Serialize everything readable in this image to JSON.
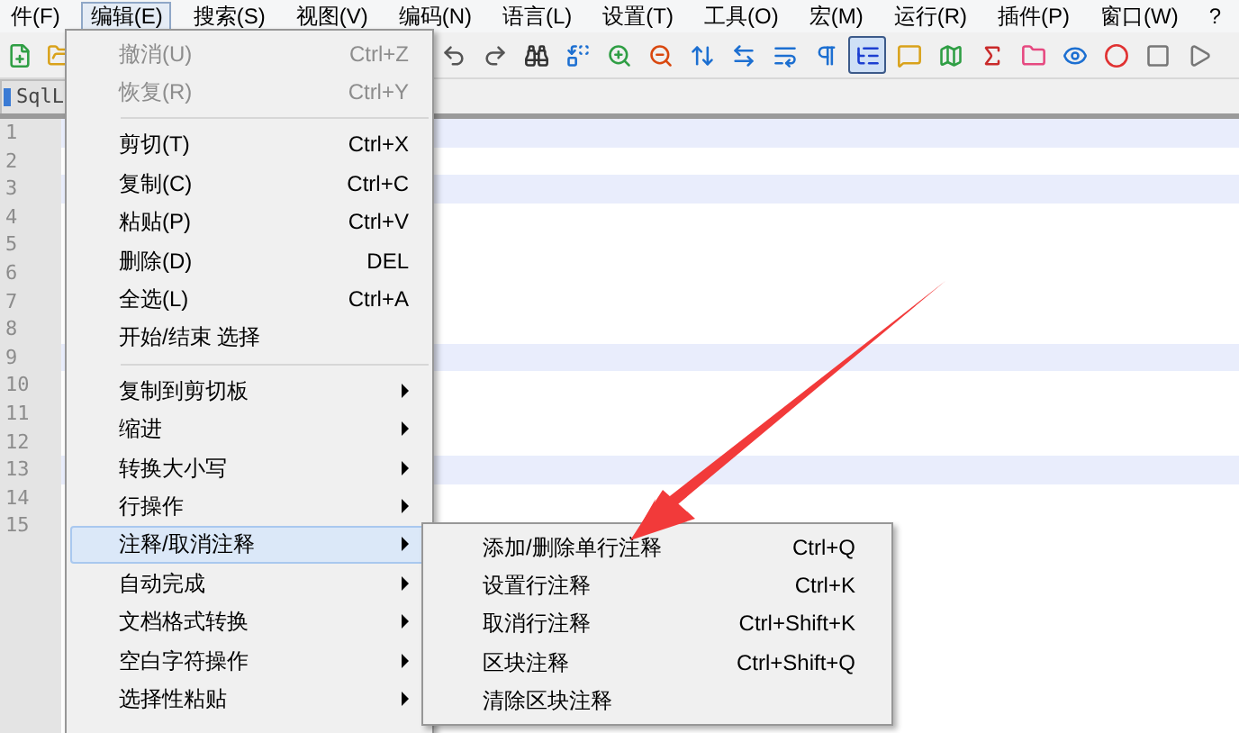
{
  "menubar": [
    {
      "label": "件(F)",
      "selected": false
    },
    {
      "label": "编辑(E)",
      "selected": true
    },
    {
      "label": "搜索(S)",
      "selected": false
    },
    {
      "label": "视图(V)",
      "selected": false
    },
    {
      "label": "编码(N)",
      "selected": false
    },
    {
      "label": "语言(L)",
      "selected": false
    },
    {
      "label": "设置(T)",
      "selected": false
    },
    {
      "label": "工具(O)",
      "selected": false
    },
    {
      "label": "宏(M)",
      "selected": false
    },
    {
      "label": "运行(R)",
      "selected": false
    },
    {
      "label": "插件(P)",
      "selected": false
    },
    {
      "label": "窗口(W)",
      "selected": false
    },
    {
      "label": "?",
      "selected": false
    }
  ],
  "toolbar": [
    {
      "kind": "new",
      "pressed": false
    },
    {
      "kind": "open",
      "pressed": false
    },
    {
      "kind": "undo",
      "pressed": false
    },
    {
      "kind": "redo",
      "pressed": false
    },
    {
      "kind": "find",
      "pressed": false
    },
    {
      "kind": "replace",
      "pressed": false
    },
    {
      "kind": "zoom-in",
      "pressed": false
    },
    {
      "kind": "zoom-out",
      "pressed": false
    },
    {
      "kind": "sync-vertical",
      "pressed": false
    },
    {
      "kind": "sync-horizontal",
      "pressed": false
    },
    {
      "kind": "wrap",
      "pressed": false
    },
    {
      "kind": "all-chars",
      "pressed": false
    },
    {
      "kind": "indent-guide",
      "pressed": true
    },
    {
      "kind": "language",
      "pressed": false
    },
    {
      "kind": "doc-map",
      "pressed": false
    },
    {
      "kind": "function-list",
      "pressed": false
    },
    {
      "kind": "folder",
      "pressed": false
    },
    {
      "kind": "monitor",
      "pressed": false
    },
    {
      "kind": "record",
      "pressed": false
    },
    {
      "kind": "stop",
      "pressed": false
    },
    {
      "kind": "play",
      "pressed": false
    }
  ],
  "tab": {
    "label": "SqlL"
  },
  "editor": {
    "lines": [
      {
        "number": "1",
        "highlighted": true
      },
      {
        "number": "2",
        "highlighted": false
      },
      {
        "number": "3",
        "highlighted": true
      },
      {
        "number": "4",
        "highlighted": false
      },
      {
        "number": "5",
        "highlighted": false
      },
      {
        "number": "6",
        "highlighted": false
      },
      {
        "number": "7",
        "highlighted": false
      },
      {
        "number": "8",
        "highlighted": false
      },
      {
        "number": "9",
        "highlighted": true
      },
      {
        "number": "10",
        "highlighted": false
      },
      {
        "number": "11",
        "highlighted": false
      },
      {
        "number": "12",
        "highlighted": false
      },
      {
        "number": "13",
        "highlighted": true
      },
      {
        "number": "14",
        "highlighted": false
      },
      {
        "number": "15",
        "highlighted": false
      }
    ]
  },
  "edit_menu": {
    "items": [
      {
        "kind": "command",
        "label": "撤消(U)",
        "shortcut": "Ctrl+Z",
        "disabled": true,
        "selected": false
      },
      {
        "kind": "command",
        "label": "恢复(R)",
        "shortcut": "Ctrl+Y",
        "disabled": true,
        "selected": false
      },
      {
        "kind": "separator"
      },
      {
        "kind": "command",
        "label": "剪切(T)",
        "shortcut": "Ctrl+X",
        "disabled": false,
        "selected": false
      },
      {
        "kind": "command",
        "label": "复制(C)",
        "shortcut": "Ctrl+C",
        "disabled": false,
        "selected": false
      },
      {
        "kind": "command",
        "label": "粘贴(P)",
        "shortcut": "Ctrl+V",
        "disabled": false,
        "selected": false
      },
      {
        "kind": "command",
        "label": "删除(D)",
        "shortcut": "DEL",
        "disabled": false,
        "selected": false
      },
      {
        "kind": "command",
        "label": "全选(L)",
        "shortcut": "Ctrl+A",
        "disabled": false,
        "selected": false
      },
      {
        "kind": "command",
        "label": "开始/结束 选择",
        "disabled": false,
        "selected": false
      },
      {
        "kind": "separator"
      },
      {
        "kind": "submenu",
        "label": "复制到剪切板",
        "disabled": false,
        "selected": false
      },
      {
        "kind": "submenu",
        "label": "缩进",
        "disabled": false,
        "selected": false
      },
      {
        "kind": "submenu",
        "label": "转换大小写",
        "disabled": false,
        "selected": false
      },
      {
        "kind": "submenu",
        "label": "行操作",
        "disabled": false,
        "selected": false
      },
      {
        "kind": "submenu",
        "label": "注释/取消注释",
        "disabled": false,
        "selected": true
      },
      {
        "kind": "submenu",
        "label": "自动完成",
        "disabled": false,
        "selected": false
      },
      {
        "kind": "submenu",
        "label": "文档格式转换",
        "disabled": false,
        "selected": false
      },
      {
        "kind": "submenu",
        "label": "空白字符操作",
        "disabled": false,
        "selected": false
      },
      {
        "kind": "submenu",
        "label": "选择性粘贴",
        "disabled": false,
        "selected": false
      }
    ]
  },
  "comment_submenu": {
    "items": [
      {
        "label": "添加/删除单行注释",
        "shortcut": "Ctrl+Q"
      },
      {
        "label": "设置行注释",
        "shortcut": "Ctrl+K"
      },
      {
        "label": "取消行注释",
        "shortcut": "Ctrl+Shift+K"
      },
      {
        "label": "区块注释",
        "shortcut": "Ctrl+Shift+Q"
      },
      {
        "label": "清除区块注释"
      }
    ]
  }
}
